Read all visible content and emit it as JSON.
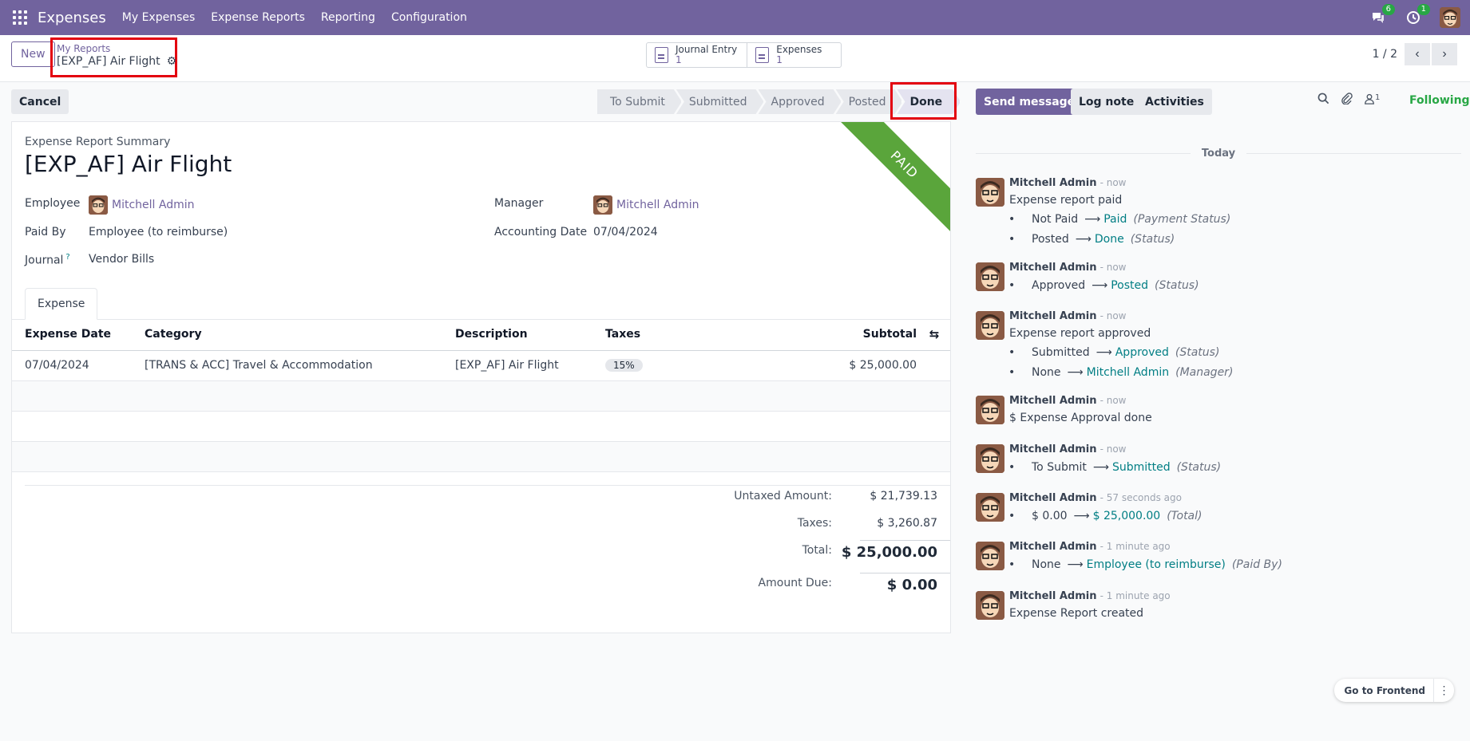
{
  "navbar": {
    "brand": "Expenses",
    "menu": [
      "My Expenses",
      "Expense Reports",
      "Reporting",
      "Configuration"
    ],
    "messages_badge": "6",
    "activities_badge": "1"
  },
  "control": {
    "new_label": "New",
    "breadcrumb_parent": "My Reports",
    "breadcrumb_current": "[EXP_AF] Air Flight",
    "smart_buttons": [
      {
        "label": "Journal Entry",
        "count": "1"
      },
      {
        "label": "Expenses",
        "count": "1"
      }
    ],
    "pager": "1 / 2"
  },
  "statusbar": {
    "cancel_label": "Cancel",
    "stages": [
      "To Submit",
      "Submitted",
      "Approved",
      "Posted",
      "Done"
    ],
    "current": "Done"
  },
  "sheet": {
    "ribbon": "PAID",
    "subtitle": "Expense Report Summary",
    "title": "[EXP_AF] Air Flight",
    "fields": {
      "employee_label": "Employee",
      "employee_value": "Mitchell Admin",
      "paid_by_label": "Paid By",
      "paid_by_value": "Employee (to reimburse)",
      "journal_label": "Journal",
      "journal_help": "?",
      "journal_value": "Vendor Bills",
      "manager_label": "Manager",
      "manager_value": "Mitchell Admin",
      "accounting_date_label": "Accounting Date",
      "accounting_date_value": "07/04/2024"
    },
    "tab": "Expense",
    "columns": [
      "Expense Date",
      "Category",
      "Description",
      "Taxes",
      "Subtotal"
    ],
    "lines": [
      {
        "date": "07/04/2024",
        "category": "[TRANS & ACC] Travel & Accommodation",
        "description": "[EXP_AF] Air Flight",
        "tax": "15%",
        "subtotal": "$ 25,000.00"
      }
    ],
    "totals": {
      "untaxed_label": "Untaxed Amount:",
      "untaxed_value": "$ 21,739.13",
      "taxes_label": "Taxes:",
      "taxes_value": "$ 3,260.87",
      "total_label": "Total:",
      "total_value": "$ 25,000.00",
      "due_label": "Amount Due:",
      "due_value": "$ 0.00"
    }
  },
  "chatter": {
    "send_label": "Send message",
    "log_label": "Log note",
    "activities_label": "Activities",
    "followers_count": "1",
    "following_label": "Following",
    "today_label": "Today",
    "messages": [
      {
        "author": "Mitchell Admin",
        "date": "- now",
        "text": "Expense report paid",
        "changes": [
          {
            "old": "Not Paid",
            "new": "Paid",
            "field": "(Payment Status)"
          },
          {
            "old": "Posted",
            "new": "Done",
            "field": "(Status)"
          }
        ]
      },
      {
        "author": "Mitchell Admin",
        "date": "- now",
        "text": "",
        "changes": [
          {
            "old": "Approved",
            "new": "Posted",
            "field": "(Status)"
          }
        ]
      },
      {
        "author": "Mitchell Admin",
        "date": "- now",
        "text": "Expense report approved",
        "changes": [
          {
            "old": "Submitted",
            "new": "Approved",
            "field": "(Status)"
          },
          {
            "old": "None",
            "new": "Mitchell Admin",
            "field": "(Manager)"
          }
        ]
      },
      {
        "author": "Mitchell Admin",
        "date": "- now",
        "text": "$ Expense Approval done",
        "changes": []
      },
      {
        "author": "Mitchell Admin",
        "date": "- now",
        "text": "",
        "changes": [
          {
            "old": "To Submit",
            "new": "Submitted",
            "field": "(Status)"
          }
        ]
      },
      {
        "author": "Mitchell Admin",
        "date": "- 57 seconds ago",
        "text": "",
        "changes": [
          {
            "old": "$ 0.00",
            "new": "$ 25,000.00",
            "field": "(Total)"
          }
        ]
      },
      {
        "author": "Mitchell Admin",
        "date": "- 1 minute ago",
        "text": "",
        "changes": [
          {
            "old": "None",
            "new": "Employee (to reimburse)",
            "field": "(Paid By)"
          }
        ]
      },
      {
        "author": "Mitchell Admin",
        "date": "- 1 minute ago",
        "text": "Expense Report created",
        "changes": []
      }
    ]
  },
  "frontend_label": "Go to Frontend"
}
